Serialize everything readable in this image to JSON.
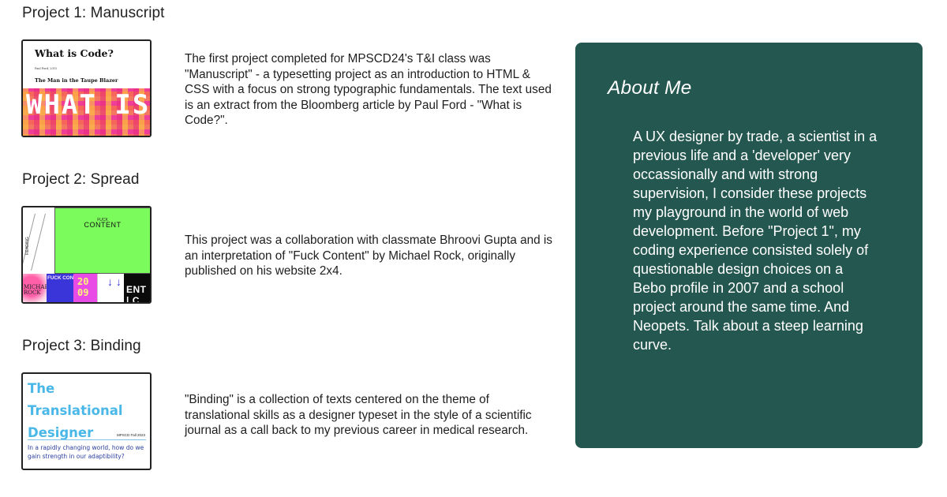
{
  "projects": [
    {
      "title": "Project 1: Manuscript",
      "description": "The first project completed for MPSCD24's T&I class was \"Manuscript\" - a typesetting project as an introduction to HTML & CSS with a focus on strong typographic fundamentals. The text used is an extract from the Bloomberg article by Paul Ford - \"What is Code?\".",
      "thumb": {
        "title": "What is Code?",
        "byline": "Paul Ford, 2015",
        "subtitle": "The Man in the Taupe Blazer",
        "big_text": "WHAT IS CODE?"
      }
    },
    {
      "title": "Project 2: Spread",
      "description": "This project was a collaboration with classmate Bhroovi Gupta and is an interpretation of \"Fuck Content\" by Michael Rock, originally published on his website 2x4.",
      "thumb": {
        "small_top": "FUCK",
        "content": "CONTENT",
        "stripe_label": "READING",
        "tile1": "MICHAEL ROCK",
        "tile2": "FUCK CONTENT CONTENT FUCK CONTENT FUCK FUCK CONTENT",
        "tile3": "20 09",
        "tile4": "↓ ↓",
        "tile5": "ENT | C"
      }
    },
    {
      "title": "Project 3: Binding",
      "description": "\"Binding\" is a collection of texts centered on the theme of translational skills as a designer typeset in the style of a scientific journal as a call back to my previous career in medical research.",
      "thumb": {
        "title": "The Translational Designer",
        "meta": "MPSCD Fall 2023",
        "question": "In a rapidly changing world, how do we gain strength in our adaptibility?"
      }
    }
  ],
  "about": {
    "title": "About Me",
    "body": "A UX designer by trade, a scientist in a previous life and a 'developer' very occassionally and with strong supervision, I consider these projects my playground in the world of web development. Before \"Project 1\", my coding experience consisted solely of questionable design choices on a Bebo profile in 2007 and a school project around the same time. And Neopets. Talk about a steep learning curve."
  },
  "colors": {
    "about_bg": "#245750",
    "accent_green": "#7bfb5c",
    "binding_blue": "#49b8e8"
  }
}
